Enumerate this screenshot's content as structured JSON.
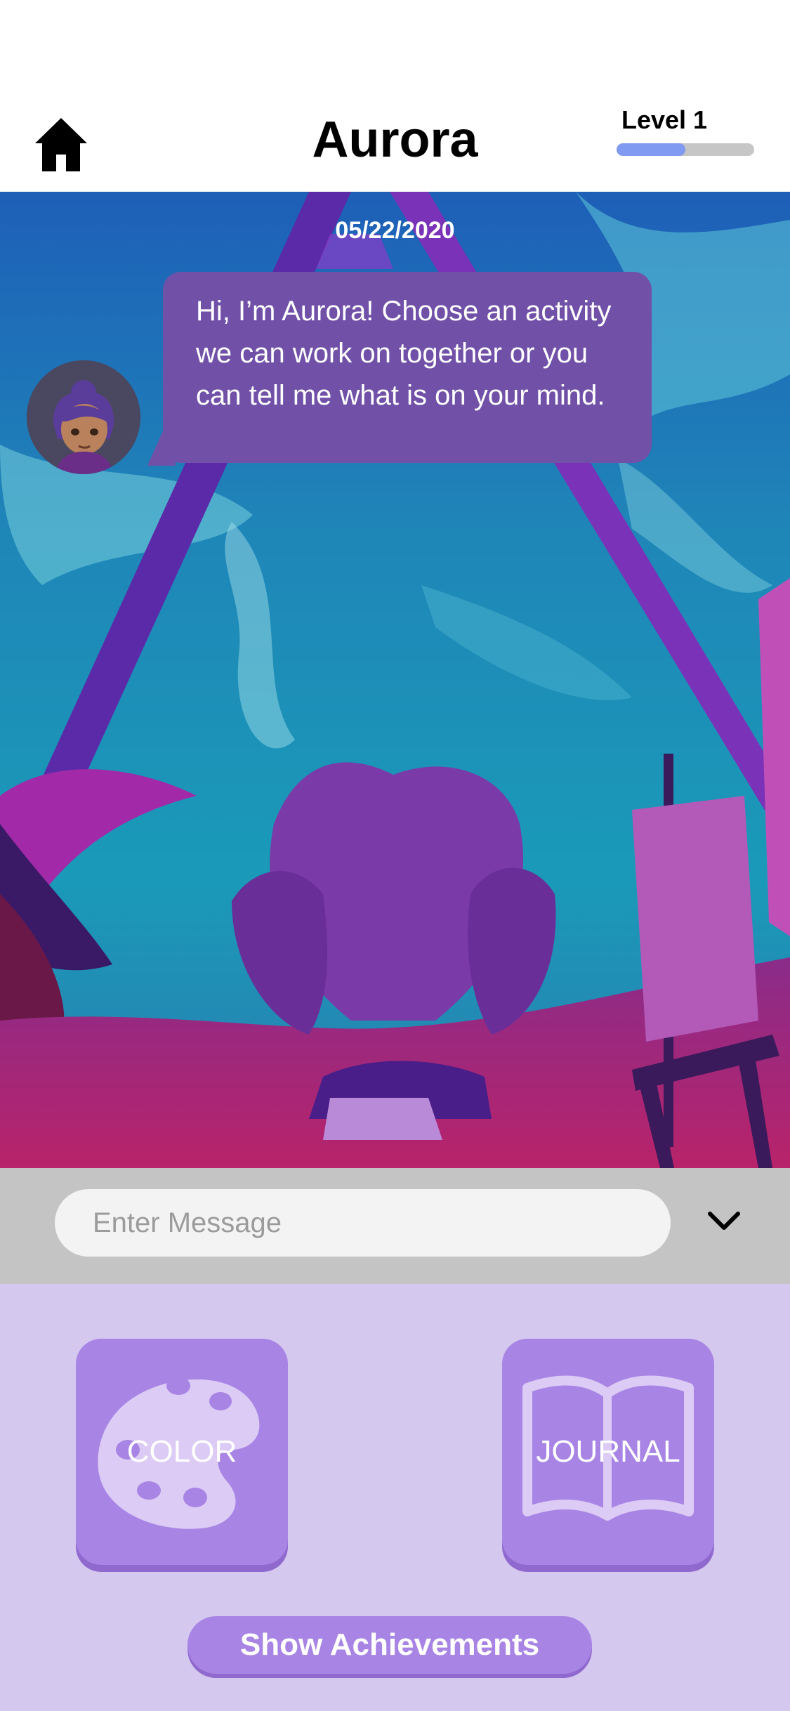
{
  "header": {
    "title": "Aurora",
    "home_icon": "home-icon",
    "level_label": "Level 1",
    "level_progress": 0.5,
    "level_fill_color": "#7f9af0"
  },
  "chat": {
    "date": "05/22/2020",
    "bot_message": "Hi, I’m Aurora! Choose an activity we can work on together or you can tell me what is on your mind.",
    "bubble_color": "#7151a8",
    "avatar": "aurora-avatar"
  },
  "input": {
    "placeholder": "Enter Message",
    "value": "",
    "toggle_icon": "chevron-down-icon"
  },
  "activities": [
    {
      "label": "COLOR",
      "icon": "palette-icon"
    },
    {
      "label": "JOURNAL",
      "icon": "open-book-icon"
    }
  ],
  "achievements_label": "Show Achievements",
  "colors": {
    "panel_bg": "#d4c8ef",
    "tile": "#a884e4",
    "input_bar": "#c4c4c4"
  }
}
